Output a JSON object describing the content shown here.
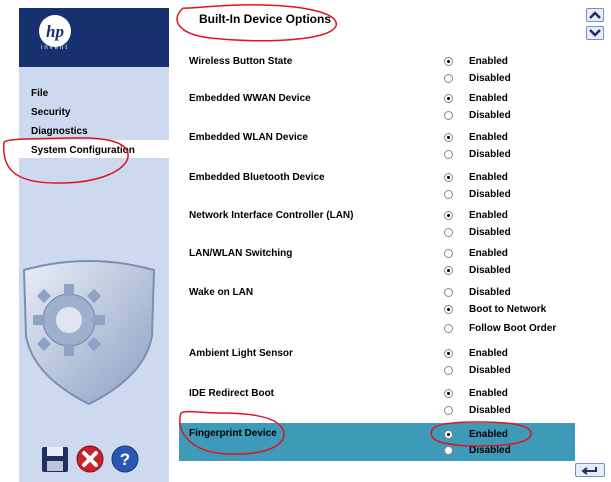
{
  "sidebar": {
    "logo_text": "invent",
    "logo_mark": "hp",
    "items": [
      {
        "label": "File",
        "top": 0
      },
      {
        "label": "Security",
        "top": 0
      },
      {
        "label": "Diagnostics",
        "top": 0
      },
      {
        "label": "System Configuration",
        "top": 0
      }
    ],
    "footer_icons": [
      "save-icon",
      "cancel-icon",
      "help-icon"
    ]
  },
  "page_title": "Built-In Device Options",
  "options": [
    {
      "label": "Wireless Button State",
      "choices": [
        "Enabled",
        "Disabled"
      ],
      "selected": 0
    },
    {
      "label": "Embedded WWAN Device",
      "choices": [
        "Enabled",
        "Disabled"
      ],
      "selected": 0
    },
    {
      "label": "Embedded WLAN Device",
      "choices": [
        "Enabled",
        "Disabled"
      ],
      "selected": 0
    },
    {
      "label": "Embedded Bluetooth Device",
      "choices": [
        "Enabled",
        "Disabled"
      ],
      "selected": 0
    },
    {
      "label": "Network Interface Controller (LAN)",
      "choices": [
        "Enabled",
        "Disabled"
      ],
      "selected": 0
    },
    {
      "label": "LAN/WLAN Switching",
      "choices": [
        "Enabled",
        "Disabled"
      ],
      "selected": 1
    },
    {
      "label": "Wake on LAN",
      "choices": [
        "Disabled",
        "Boot to Network",
        "Follow Boot Order"
      ],
      "selected": 1
    },
    {
      "label": "Ambient Light Sensor",
      "choices": [
        "Enabled",
        "Disabled"
      ],
      "selected": 0
    },
    {
      "label": "IDE Redirect Boot",
      "choices": [
        "Enabled",
        "Disabled"
      ],
      "selected": 0
    },
    {
      "label": "Fingerprint Device",
      "choices": [
        "Enabled",
        "Disabled"
      ],
      "selected": 0
    }
  ],
  "colors": {
    "header": "#17306e",
    "sidebar": "#cdd9ee",
    "highlight": "#3d9ab9",
    "annotation": "#e0141e"
  }
}
